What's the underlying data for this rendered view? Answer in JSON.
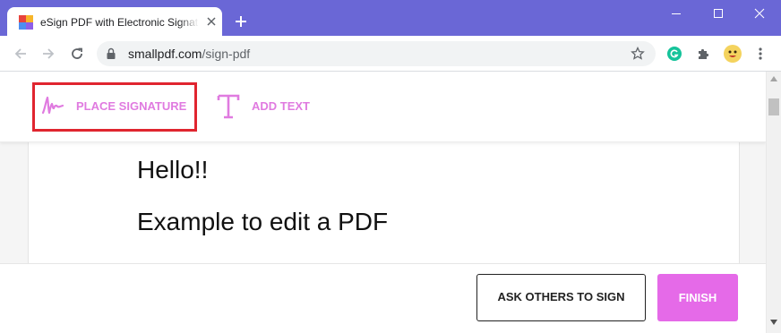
{
  "browser": {
    "tab": {
      "title": "eSign PDF with Electronic Signature",
      "favicon": "smallpdf-favicon",
      "close_icon": "close-icon"
    },
    "new_tab_icon": "plus-icon",
    "window_controls": [
      "minimize-icon",
      "maximize-icon",
      "close-icon"
    ],
    "address": {
      "host": "smallpdf.com",
      "path": "/sign-pdf",
      "lock_icon": "lock-icon",
      "bookmark_icon": "star-icon"
    },
    "nav_icons": [
      "back-arrow-icon",
      "forward-arrow-icon",
      "reload-icon"
    ],
    "extensions": [
      "grammarly-icon",
      "puzzle-icon"
    ],
    "profile_icon": "avatar",
    "menu_icon": "kebab-menu-icon"
  },
  "editor_toolbar": {
    "place_signature": {
      "label": "PLACE SIGNATURE",
      "icon": "signature-icon",
      "highlighted": true
    },
    "add_text": {
      "label": "ADD TEXT",
      "icon": "text-icon"
    }
  },
  "document": {
    "lines": [
      "Hello!!",
      "Example to edit a PDF"
    ]
  },
  "footer": {
    "ask_others_label": "ASK OTHERS TO SIGN",
    "finish_label": "FINISH"
  },
  "colors": {
    "titlebar": "#6a67d6",
    "accent_pink": "#e07be0",
    "finish_button": "#e56ae8",
    "highlight_frame": "#e0252f"
  }
}
